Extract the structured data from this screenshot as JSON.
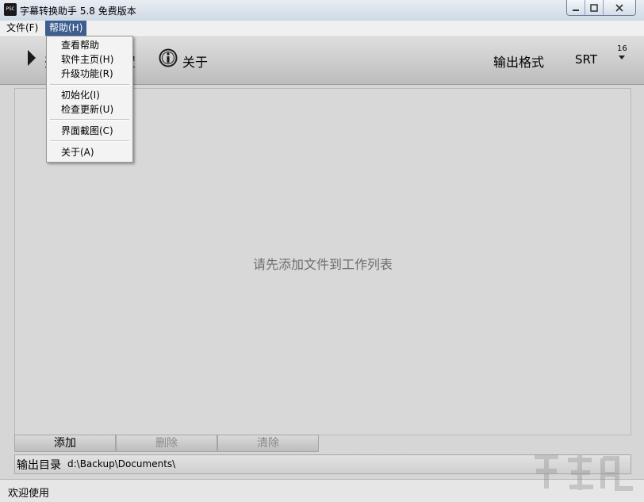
{
  "window": {
    "icon_text": "PSC",
    "title": "字幕转换助手 5.8 免费版本",
    "min_label": "▁",
    "max_label": "▢",
    "close_label": "✕"
  },
  "menubar": {
    "file": "文件(F)",
    "help": "帮助(H)"
  },
  "help_menu": {
    "items": [
      "查看帮助",
      "软件主页(H)",
      "升级功能(R)",
      "初始化(I)",
      "检查更新(U)",
      "界面截图(C)",
      "关于(A)"
    ]
  },
  "toolbar": {
    "start_label": "开",
    "settings_label": "置",
    "about_label": "关于",
    "format_label": "输出格式",
    "format_value": "SRT",
    "format_count": "16"
  },
  "worklist": {
    "empty_hint": "请先添加文件到工作列表"
  },
  "actions": {
    "add": "添加",
    "delete": "删除",
    "clear": "清除"
  },
  "output": {
    "label": "输出目录",
    "path": "d:\\Backup\\Documents\\"
  },
  "status": {
    "text": "欢迎使用"
  },
  "colors": {
    "menu_highlight": "#3d5e8e",
    "disabled_text": "#8a8a8a"
  }
}
